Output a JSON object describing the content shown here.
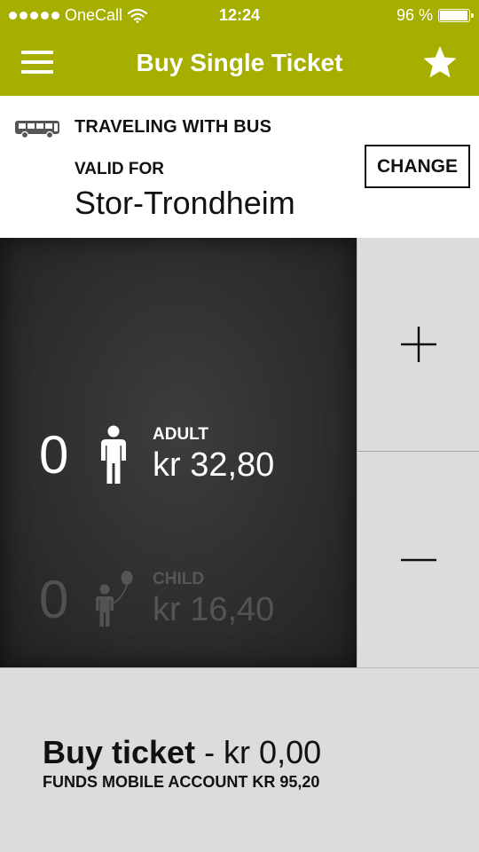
{
  "status_bar": {
    "carrier": "OneCall",
    "time": "12:24",
    "battery_percent": "96 %",
    "battery_level": 0.96
  },
  "header": {
    "title": "Buy Single Ticket",
    "menu_icon": "hamburger-menu-icon",
    "favorite_icon": "star-icon",
    "accent_color": "#a6ae00"
  },
  "trip": {
    "mode_icon": "bus-icon",
    "traveling": "TRAVELING WITH BUS",
    "valid_label": "VALID FOR",
    "zone": "Stor-Trondheim",
    "change_label": "CHANGE"
  },
  "passengers": [
    {
      "count": "0",
      "label": "ADULT",
      "price": "kr 32,80",
      "icon": "adult-person-icon",
      "selected": true
    },
    {
      "count": "0",
      "label": "CHILD",
      "price": "kr 16,40",
      "icon": "child-with-balloon-icon",
      "selected": false
    }
  ],
  "stepper": {
    "increment_icon": "plus-icon",
    "decrement_icon": "minus-icon"
  },
  "footer": {
    "buy_label": "Buy ticket",
    "buy_price": " - kr 0,00",
    "funds": "FUNDS MOBILE ACCOUNT KR 95,20"
  }
}
